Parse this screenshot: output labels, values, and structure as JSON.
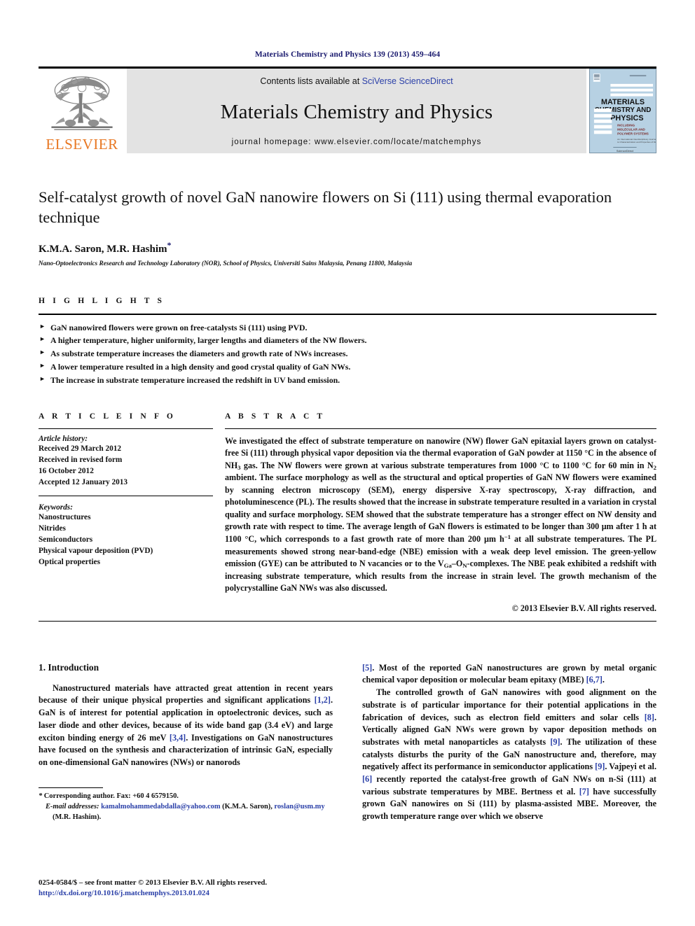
{
  "running_head": "Materials Chemistry and Physics 139 (2013) 459–464",
  "masthead": {
    "publisher_name": "ELSEVIER",
    "contents_prefix": "Contents lists available at ",
    "contents_link": "SciVerse ScienceDirect",
    "journal_name": "Materials Chemistry and Physics",
    "homepage_line": "journal homepage: www.elsevier.com/locate/matchemphys",
    "cover_title_line1": "MATERIALS",
    "cover_title_line2": "CHEMISTRY AND",
    "cover_title_line3": "PHYSICS",
    "link_color": "#2b40a8",
    "elsevier_orange": "#E87722",
    "band_color": "#e3e3e3"
  },
  "article": {
    "title": "Self-catalyst growth of novel GaN nanowire flowers on Si (111) using thermal evaporation technique",
    "authors": "K.M.A. Saron, M.R. Hashim",
    "corresponding_marker": "*",
    "affiliation": "Nano-Optoelectronics Research and Technology Laboratory (NOR), School of Physics, Universiti Sains Malaysia, Penang 11800, Malaysia"
  },
  "highlights": {
    "label": "H I G H L I G H T S",
    "bullet_glyph": "►",
    "items": [
      "GaN nanowired flowers were grown on free-catalysts Si (111) using PVD.",
      "A higher temperature, higher uniformity, larger lengths and diameters of the NW flowers.",
      "As substrate temperature increases the diameters and growth rate of NWs increases.",
      "A lower temperature resulted in a high density and good crystal quality of GaN NWs.",
      "The increase in substrate temperature increased the redshift in UV band emission."
    ]
  },
  "article_info": {
    "label": "A R T I C L E   I N F O",
    "history_label": "Article history:",
    "history_lines": [
      "Received 29 March 2012",
      "Received in revised form",
      "16 October 2012",
      "Accepted 12 January 2013"
    ],
    "keywords_label": "Keywords:",
    "keywords": [
      "Nanostructures",
      "Nitrides",
      "Semiconductors",
      "Physical vapour deposition (PVD)",
      "Optical properties"
    ]
  },
  "abstract": {
    "label": "A B S T R A C T",
    "paragraph_html": "We investigated the effect of substrate temperature on nanowire (NW) flower GaN epitaxial layers grown on catalyst-free Si (111) through physical vapor deposition via the thermal evaporation of GaN powder at 1150 &deg;C in the absence of NH<sub>3</sub> gas. The NW flowers were grown at various substrate temperatures from 1000 &deg;C to 1100 &deg;C for 60 min in N<sub>2</sub> ambient. The surface morphology as well as the structural and optical properties of GaN NW flowers were examined by scanning electron microscopy (SEM), energy dispersive X-ray spectroscopy, X-ray diffraction, and photoluminescence (PL). The results showed that the increase in substrate temperature resulted in a variation in crystal quality and surface morphology. SEM showed that the substrate temperature has a stronger effect on NW density and growth rate with respect to time. The average length of GaN flowers is estimated to be longer than 300 &mu;m after 1 h at 1100 &deg;C, which corresponds to a fast growth rate of more than 200 &mu;m h<sup>&minus;1</sup> at all substrate temperatures. The PL measurements showed strong near-band-edge (NBE) emission with a weak deep level emission. The green-yellow emission (GYE) can be attributed to N vacancies or to the V<sub>Ga</sub>&ndash;O<sub>N</sub>-complexes. The NBE peak exhibited a redshift with increasing substrate temperature, which results from the increase in strain level. The growth mechanism of the polycrystalline GaN NWs was also discussed.",
    "copyright": "© 2013 Elsevier B.V. All rights reserved."
  },
  "body": {
    "section_number_title": "1.  Introduction",
    "left_paragraph_html": "Nanostructured materials have attracted great attention in recent years because of their unique physical properties and significant applications <span class=\"ref\">[1,2]</span>. GaN is of interest for potential application in optoelectronic devices, such as laser diode and other devices, because of its wide band gap (3.4 eV) and large exciton binding energy of 26 meV <span class=\"ref\">[3,4]</span>. Investigations on GaN nanostructures have focused on the synthesis and characterization of intrinsic GaN, especially on one-dimensional GaN nanowires (NWs) or nanorods",
    "right_paragraph_1_html": "<span class=\"ref\">[5]</span>. Most of the reported GaN nanostructures are grown by metal organic chemical vapor deposition or molecular beam epitaxy (MBE) <span class=\"ref\">[6,7]</span>.",
    "right_paragraph_2_html": "The controlled growth of GaN nanowires with good alignment on the substrate is of particular importance for their potential applications in the fabrication of devices, such as electron field emitters and solar cells <span class=\"ref\">[8]</span>. Vertically aligned GaN NWs were grown by vapor deposition methods on substrates with metal nanoparticles as catalysts <span class=\"ref\">[9]</span>. The utilization of these catalysts disturbs the purity of the GaN nanostructure and, therefore, may negatively affect its performance in semiconductor applications <span class=\"ref\">[9]</span>. Vajpeyi et al. <span class=\"ref\">[6]</span> recently reported the catalyst-free growth of GaN NWs on n-Si (111) at various substrate temperatures by MBE. Bertness et al. <span class=\"ref\">[7]</span> have successfully grown GaN nanowires on Si (111) by plasma-assisted MBE. Moreover, the growth temperature range over which we observe"
  },
  "footnotes": {
    "corresponding_html": "<span class=\"lbl\">*</span>  Corresponding author. Fax: +60 4 6579150.",
    "email_html": "<span class=\"lbl\">E-mail addresses:</span> <span class=\"link\">kamalmohammedabdalla@yahoo.com</span> (K.M.A. Saron), <span class=\"link\">roslan@usm.my</span> (M.R. Hashim)."
  },
  "imprint": {
    "line1": "0254-0584/$ – see front matter © 2013 Elsevier B.V. All rights reserved.",
    "doi": "http://dx.doi.org/10.1016/j.matchemphys.2013.01.024"
  }
}
